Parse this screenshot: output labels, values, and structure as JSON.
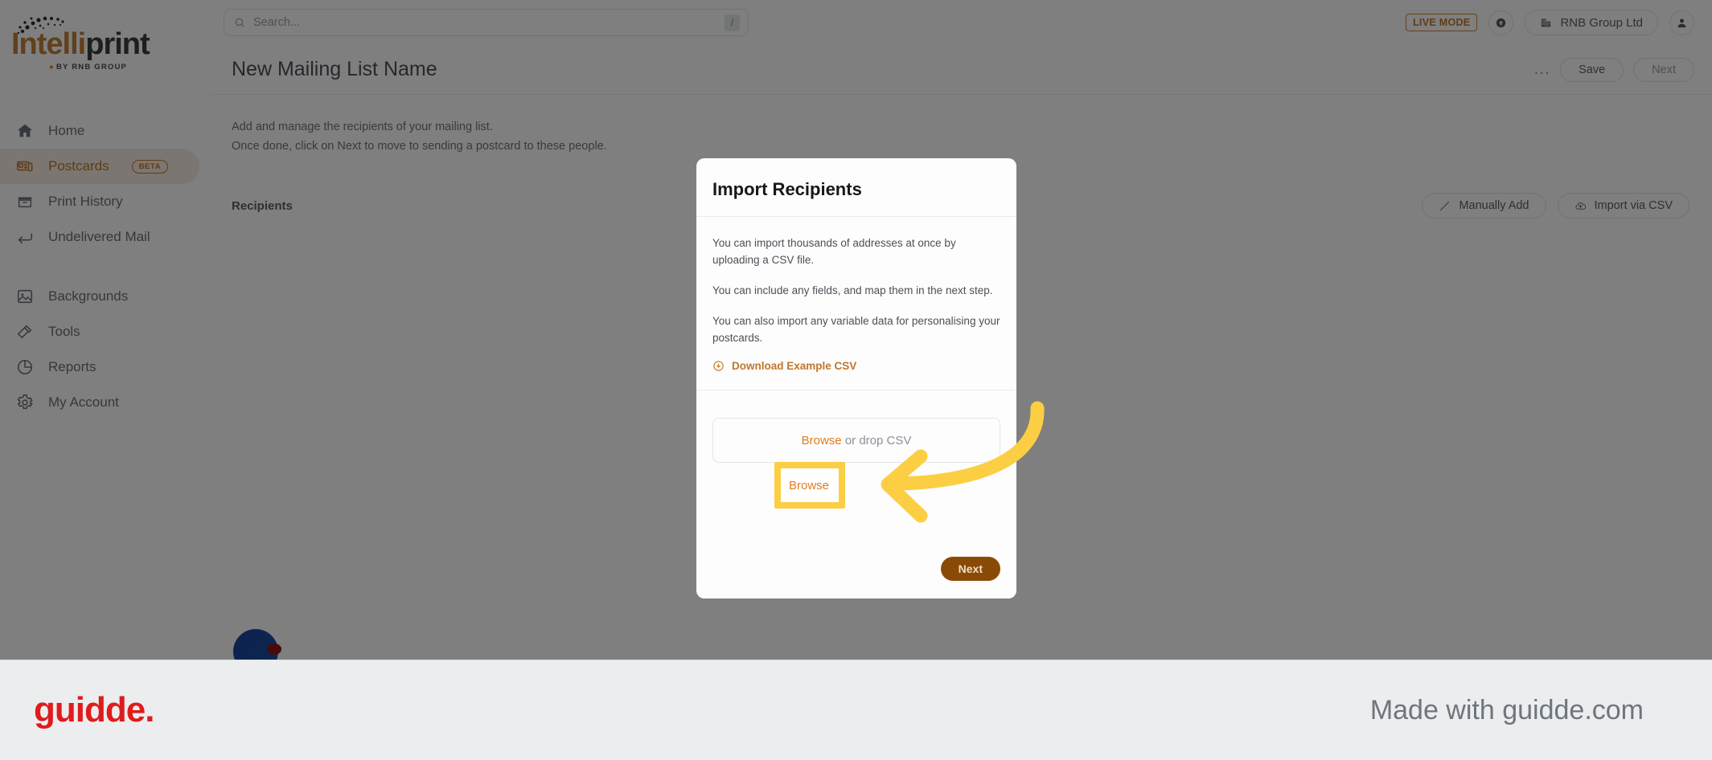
{
  "brand": {
    "logo_primary": "Intelli",
    "logo_secondary": "print",
    "logo_subtitle": "BY RNB GROUP",
    "accent_color": "#c2762a",
    "highlight_color": "#fcce43"
  },
  "sidebar": {
    "items": [
      {
        "label": "Home",
        "icon": "home-icon",
        "active": false,
        "badge": ""
      },
      {
        "label": "Postcards",
        "icon": "postcard-icon",
        "active": true,
        "badge": "BETA"
      },
      {
        "label": "Print History",
        "icon": "archive-icon",
        "active": false,
        "badge": ""
      },
      {
        "label": "Undelivered Mail",
        "icon": "return-arrow-icon",
        "active": false,
        "badge": ""
      },
      {
        "label": "Backgrounds",
        "icon": "image-icon",
        "active": false,
        "badge": ""
      },
      {
        "label": "Tools",
        "icon": "hammer-icon",
        "active": false,
        "badge": ""
      },
      {
        "label": "Reports",
        "icon": "pie-chart-icon",
        "active": false,
        "badge": ""
      },
      {
        "label": "My Account",
        "icon": "gear-icon",
        "active": false,
        "badge": ""
      }
    ]
  },
  "topbar": {
    "search_placeholder": "Search...",
    "search_value": "",
    "search_shortcut": "/",
    "live_mode_label": "LIVE MODE",
    "organization": "RNB Group Ltd"
  },
  "page": {
    "title": "New Mailing List Name",
    "more_label": "...",
    "save_label": "Save",
    "next_label": "Next",
    "description_line1": "Add and manage the recipients of your mailing list.",
    "description_line2": "Once done, click on Next to move to sending a postcard to these people.",
    "section_title": "Recipients",
    "manually_add_label": "Manually Add",
    "import_csv_label": "Import via CSV"
  },
  "modal": {
    "title": "Import Recipients",
    "paragraph1": "You can import thousands of addresses at once by uploading a CSV file.",
    "paragraph2": "You can include any fields, and map them in the next step.",
    "paragraph3": "You can also import any variable data for personalising your postcards.",
    "download_link": "Download Example CSV",
    "dropzone_browse": "Browse",
    "dropzone_rest": "or drop CSV",
    "next_label": "Next"
  },
  "highlight": {
    "label": "Browse"
  },
  "footer": {
    "logo": "guidde.",
    "tagline": "Made with guidde.com"
  }
}
